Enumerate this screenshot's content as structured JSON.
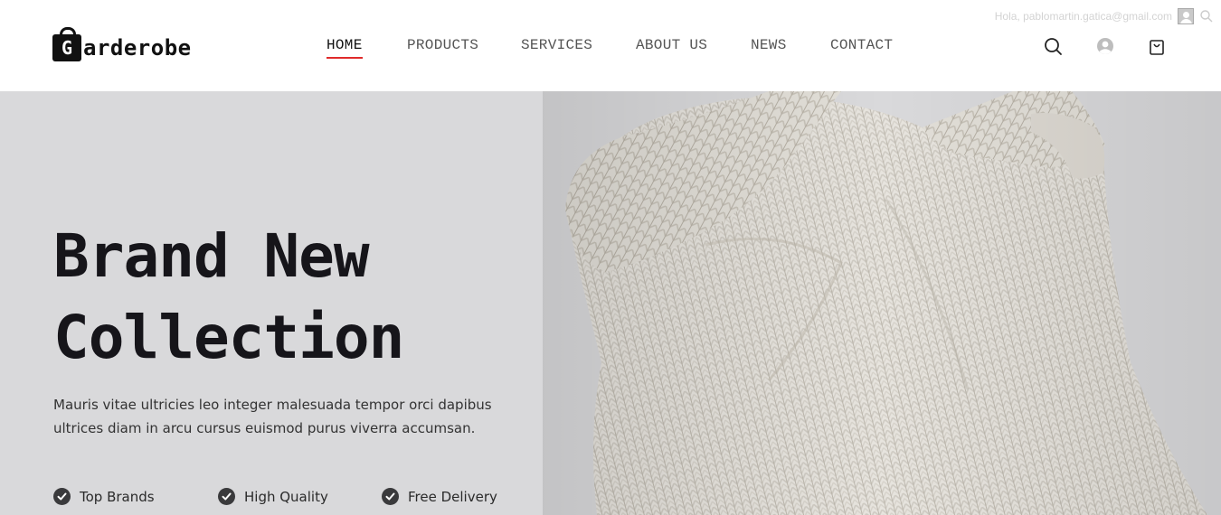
{
  "brand": {
    "logo_letter": "G",
    "logo_word": "arderobe"
  },
  "user_strip": {
    "greeting": "Hola, pablomartin.gatica@gmail.com"
  },
  "nav": {
    "items": [
      {
        "label": "HOME",
        "active": true
      },
      {
        "label": "PRODUCTS",
        "active": false
      },
      {
        "label": "SERVICES",
        "active": false
      },
      {
        "label": "ABOUT US",
        "active": false
      },
      {
        "label": "NEWS",
        "active": false
      },
      {
        "label": "CONTACT",
        "active": false
      }
    ]
  },
  "header_icons": [
    "search-icon",
    "user-icon",
    "cart-icon"
  ],
  "hero": {
    "title_line1": "Brand New",
    "title_line2": "Collection",
    "description": "Mauris vitae ultricies leo integer malesuada tempor orci dapibus ultrices diam in arcu cursus euismod purus viverra accumsan.",
    "features": [
      {
        "label": "Top Brands",
        "icon": "check-circle-icon"
      },
      {
        "label": "High Quality",
        "icon": "check-circle-icon"
      },
      {
        "label": "Free Delivery",
        "icon": "check-circle-icon"
      }
    ],
    "background_color": "#d9d9db"
  },
  "colors": {
    "accent": "#e02b2b",
    "text_dark": "#16151a"
  }
}
